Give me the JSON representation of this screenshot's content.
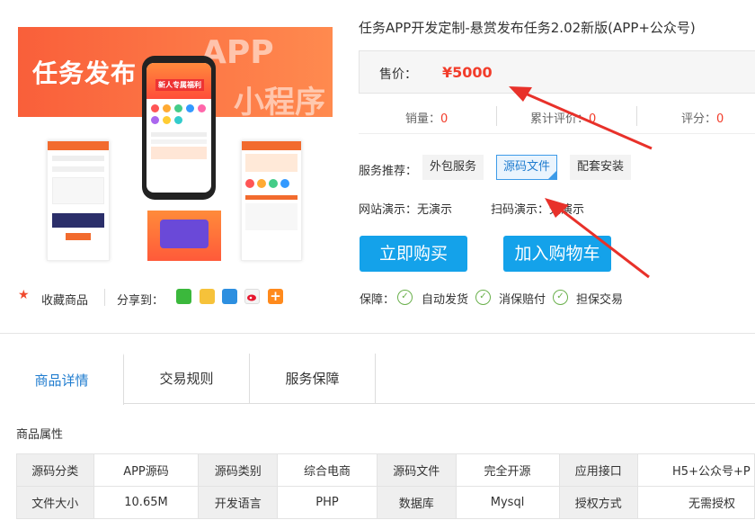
{
  "gallery": {
    "banner_title": "任务发布",
    "banner_app": "APP",
    "banner_mini": "小程序",
    "phone_badge": "新人专属福利"
  },
  "actions": {
    "favorite": "收藏商品",
    "share": "分享到："
  },
  "product": {
    "title": "任务APP开发定制-悬赏发布任务2.02新版(APP+公众号)",
    "price_label": "售价：",
    "price": "¥5000",
    "stats": [
      {
        "label": "销量：",
        "value": "0"
      },
      {
        "label": "累计评价：",
        "value": "0"
      },
      {
        "label": "评分：",
        "value": "0"
      }
    ],
    "service_label": "服务推荐：",
    "services": [
      "外包服务",
      "源码文件",
      "配套安装"
    ],
    "demo_site_label": "网站演示：",
    "demo_site_value": "无演示",
    "demo_scan_label": "扫码演示：",
    "demo_scan_value": "无演示",
    "buy_label": "立即购买",
    "cart_label": "加入购物车",
    "guarantee_label": "保障：",
    "guarantees": [
      "自动发货",
      "消保赔付",
      "担保交易"
    ]
  },
  "tabs": [
    "商品详情",
    "交易规则",
    "服务保障"
  ],
  "attributes": {
    "heading": "商品属性",
    "rows": [
      [
        "源码分类",
        "APP源码",
        "源码类别",
        "综合电商",
        "源码文件",
        "完全开源",
        "应用接口",
        "H5+公众号+P"
      ],
      [
        "文件大小",
        "10.65M",
        "开发语言",
        "PHP",
        "数据库",
        "Mysql",
        "授权方式",
        "无需授权"
      ]
    ]
  },
  "colors": {
    "price": "#f23c2a",
    "accent_blue": "#14a2ea",
    "banner_orange": "#f95f3a",
    "annotation_arrow": "#e8312a"
  }
}
